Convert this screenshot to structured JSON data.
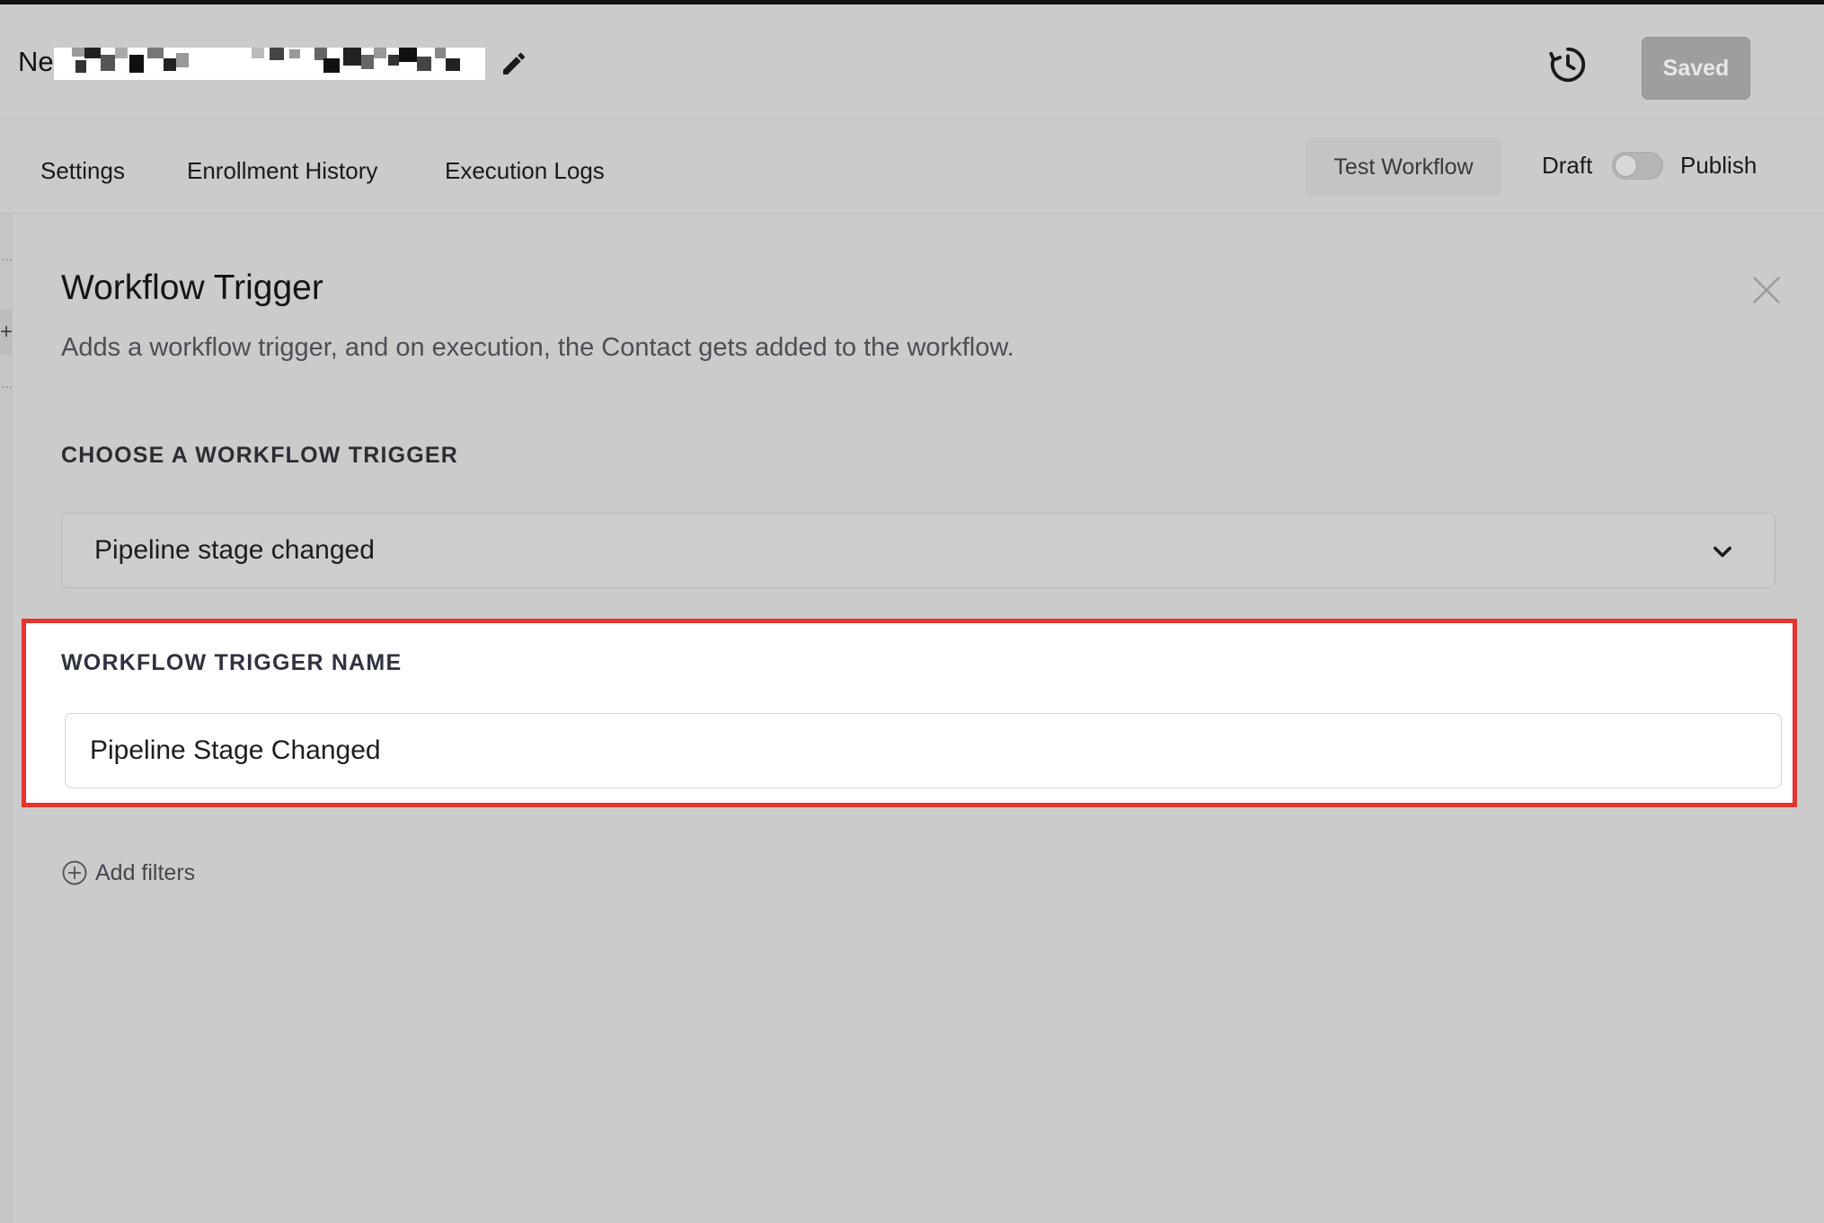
{
  "header": {
    "workflow_name_prefix": "Ne",
    "edit_icon": "pencil-icon",
    "history_icon": "history-icon",
    "saved_label": "Saved"
  },
  "tabs": [
    {
      "label": "Settings"
    },
    {
      "label": "Enrollment History"
    },
    {
      "label": "Execution Logs"
    }
  ],
  "actions": {
    "test_workflow_label": "Test Workflow",
    "draft_label": "Draft",
    "publish_label": "Publish",
    "publish_toggle_on": false
  },
  "panel": {
    "title": "Workflow Trigger",
    "description": "Adds a workflow trigger, and on execution, the Contact gets added to the workflow.",
    "close_icon": "close-icon",
    "choose_trigger_label": "CHOOSE A WORKFLOW TRIGGER",
    "selected_trigger": "Pipeline stage changed",
    "trigger_name_label": "WORKFLOW TRIGGER NAME",
    "trigger_name_value": "Pipeline Stage Changed",
    "add_filters_label": "Add filters"
  },
  "colors": {
    "highlight_border": "#e8322c",
    "background": "#cccccc"
  }
}
